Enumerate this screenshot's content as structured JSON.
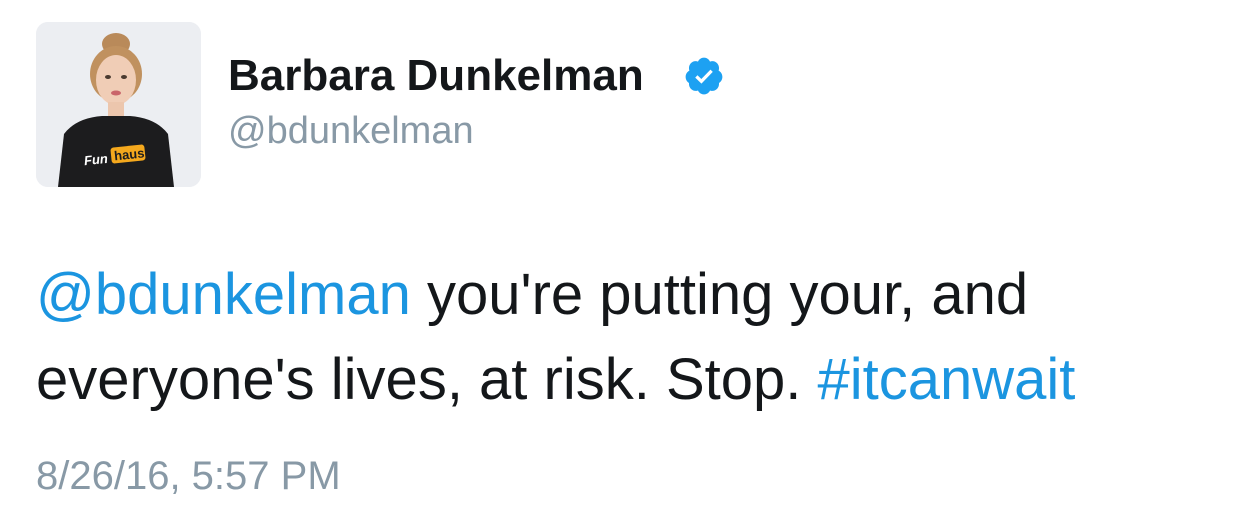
{
  "user": {
    "display_name": "Barbara Dunkelman",
    "handle": "@bdunkelman",
    "verified": true,
    "avatar_shirt_text_1": "Fun",
    "avatar_shirt_text_2": "haus"
  },
  "tweet": {
    "mention": "@bdunkelman",
    "text_main": " you're putting your, and everyone's lives, at risk. Stop. ",
    "hashtag": "#itcanwait",
    "timestamp": "8/26/16, 5:57 PM"
  },
  "colors": {
    "link": "#1b95e0",
    "text": "#14171a",
    "muted": "#8899a6",
    "verified": "#1da1f2"
  },
  "icons": {
    "verified": "verified-badge-icon"
  }
}
